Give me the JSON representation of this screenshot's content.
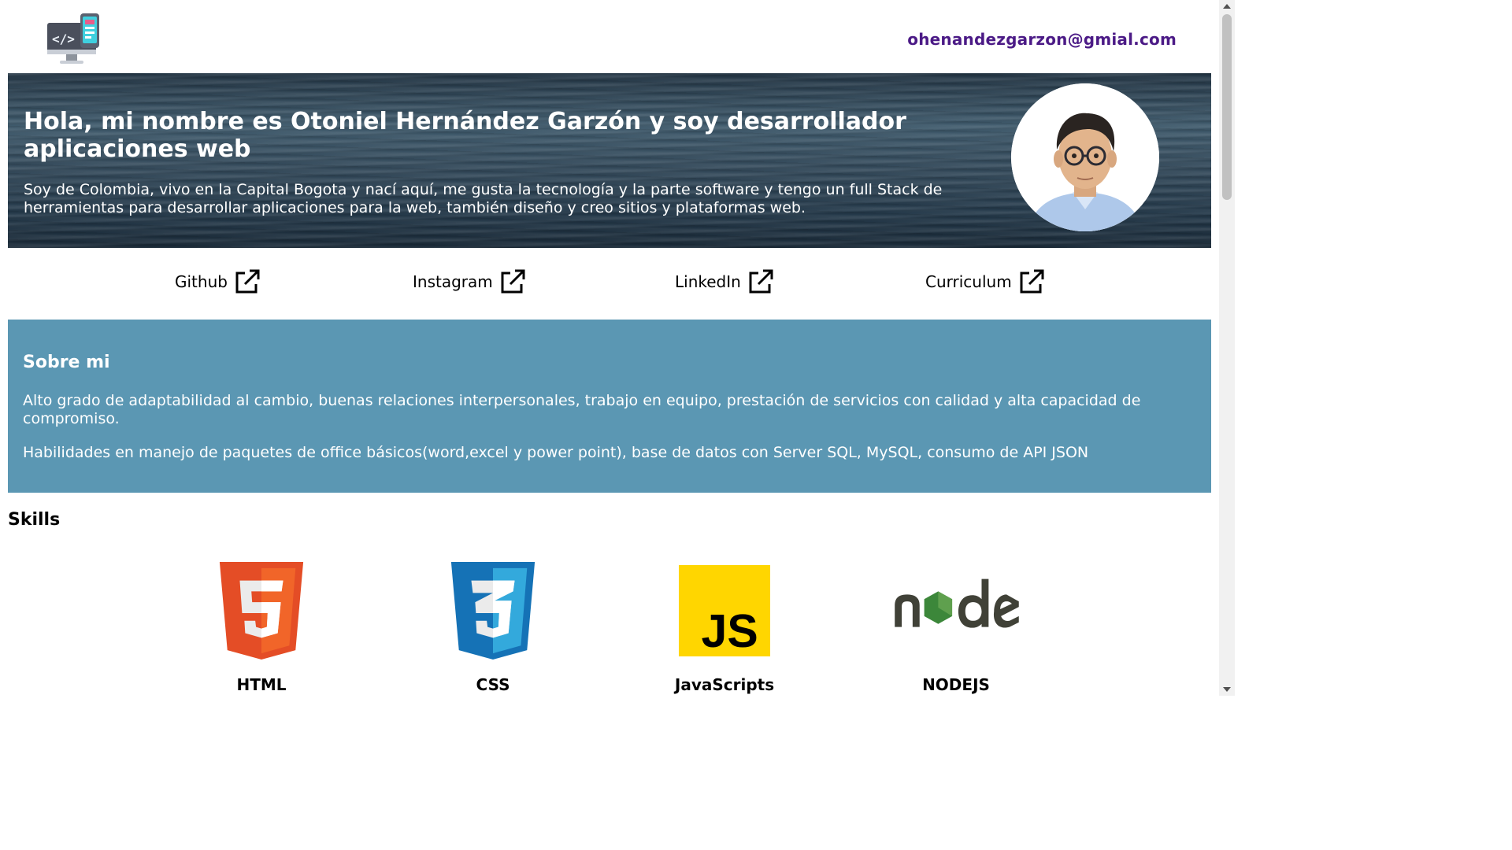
{
  "header": {
    "logo_icon": "developer-monitor-phone-icon",
    "email": "ohenandezgarzon@gmial.com",
    "email_color": "#4b1a86"
  },
  "hero": {
    "title": "Hola, mi nombre es Otoniel Hernández Garzón y soy desarrollador aplicaciones web",
    "description": "Soy de Colombia, vivo en la Capital Bogota y nací aquí, me gusta la tecnología y la parte software y tengo un full Stack de herramientas para desarrollar aplicaciones para la web, también diseño y creo sitios y plataformas web.",
    "avatar_icon": "profile-photo-avatar"
  },
  "links": [
    {
      "label": "Github",
      "icon": "external-link-icon"
    },
    {
      "label": "Instagram",
      "icon": "external-link-icon"
    },
    {
      "label": "LinkedIn",
      "icon": "external-link-icon"
    },
    {
      "label": "Curriculum",
      "icon": "external-link-icon"
    }
  ],
  "about": {
    "title": "Sobre mi",
    "paragraph1": "Alto grado de adaptabilidad al cambio, buenas relaciones interpersonales, trabajo en equipo, prestación de servicios con calidad y alta capacidad de compromiso.",
    "paragraph2": "Habilidades en manejo de paquetes de office básicos(word,excel y power point), base de datos con Server SQL, MySQL, consumo de API JSON",
    "background_color": "#5b97b3"
  },
  "skills": {
    "title": "Skills",
    "items": [
      {
        "label": "HTML",
        "icon": "html5-icon",
        "color": "#e44d26"
      },
      {
        "label": "CSS",
        "icon": "css3-icon",
        "color": "#1572b6"
      },
      {
        "label": "JavaScripts",
        "icon": "javascript-icon",
        "color": "#f7df1e"
      },
      {
        "label": "NODEJS",
        "icon": "nodejs-icon",
        "color": "#3c873a"
      }
    ]
  }
}
